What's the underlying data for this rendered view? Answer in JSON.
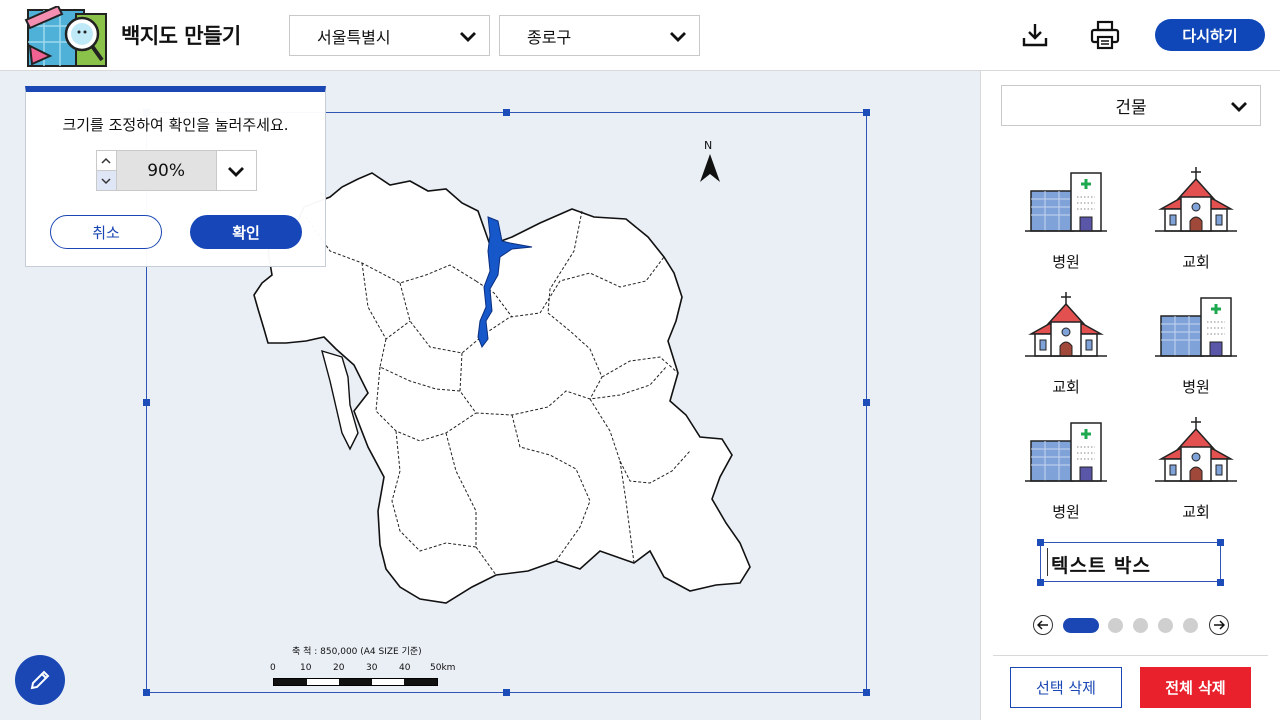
{
  "header": {
    "title": "백지도 만들기",
    "city_select": "서울특별시",
    "district_select": "종로구",
    "reset_label": "다시하기",
    "download_icon": "download-icon",
    "print_icon": "print-icon"
  },
  "popup": {
    "message": "크기를 조정하여 확인을 눌러주세요.",
    "zoom_value": "90%",
    "cancel_label": "취소",
    "confirm_label": "확인"
  },
  "map": {
    "north_label": "N",
    "scale_title": "축 척 : 850,000 (A4 SIZE 기준)",
    "scale_ticks": [
      "0",
      "10",
      "20",
      "30",
      "40",
      "50km"
    ]
  },
  "panel": {
    "category": "건물",
    "items": [
      {
        "label": "병원",
        "icon": "hospital-icon"
      },
      {
        "label": "교회",
        "icon": "church-icon"
      },
      {
        "label": "교회",
        "icon": "church-icon"
      },
      {
        "label": "병원",
        "icon": "hospital-icon"
      },
      {
        "label": "병원",
        "icon": "hospital-icon"
      },
      {
        "label": "교회",
        "icon": "church-icon"
      }
    ],
    "text_box_label": "텍스트 박스",
    "pager": {
      "total": 5,
      "current": 1
    },
    "delete_selected_label": "선택 삭제",
    "delete_all_label": "전체 삭제"
  },
  "colors": {
    "primary": "#1a47b3",
    "danger": "#e8212c",
    "canvas_bg": "#eaeff6",
    "river": "#1657c9"
  }
}
